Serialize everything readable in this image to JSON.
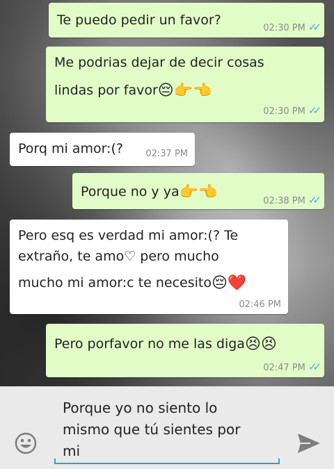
{
  "messages": [
    {
      "text": "Te puedo pedir un favor?",
      "time": "02:30 PM",
      "direction": "outgoing",
      "status": "read"
    },
    {
      "text_line1": "Me podrias dejar de decir cosas",
      "text_line2": "lindas por favor",
      "emojis": "😔👉👈",
      "time": "02:30 PM",
      "direction": "outgoing",
      "status": "read"
    },
    {
      "text": "Porq mi amor:(?",
      "time": "02:37 PM",
      "direction": "incoming"
    },
    {
      "text": "Porque no y ya",
      "emojis": "👉👈",
      "time": "02:38 PM",
      "direction": "outgoing",
      "status": "read"
    },
    {
      "text_line1": "Pero esq es verdad mi amor:(? Te",
      "text_line2": "extraño, te amo♡ pero mucho",
      "text_line3": "mucho mi amor:c te necesito",
      "emojis": "😔❤️",
      "time": "02:46 PM",
      "direction": "incoming"
    },
    {
      "text": "Pero porfavor no me las diga",
      "emojis": "😣😣",
      "time": "02:47 PM",
      "direction": "outgoing",
      "status": "read"
    }
  ],
  "composer": {
    "value": "Porque yo no siento lo mismo que tú sientes por mi",
    "line1": "Porque yo no siento lo",
    "line2": "mismo que tú sientes por",
    "line3": "mi"
  },
  "icons": {
    "emoji_button": "smiley-icon",
    "send_button": "send-icon",
    "read_ticks": "double-check-icon"
  },
  "colors": {
    "outgoing_bubble": "#e2fcc8",
    "incoming_bubble": "#ffffff",
    "read_ticks": "#4fa9e6",
    "input_underline": "#2a9fd6"
  }
}
